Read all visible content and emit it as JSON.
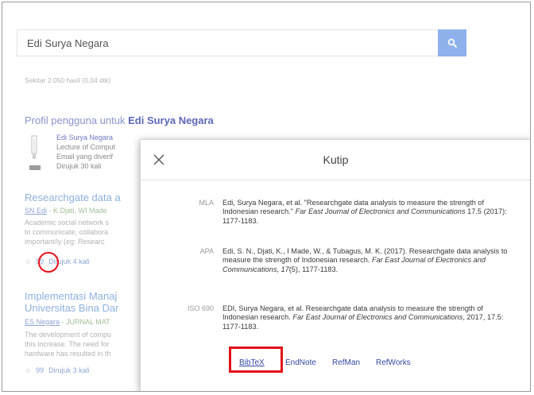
{
  "search": {
    "query": "Edi Surya Negara",
    "stats": "Sekitar 2.050 hasil (0,04 dtk)"
  },
  "profile": {
    "heading_prefix": "Profil pengguna untuk ",
    "heading_name": "Edi Surya Negara",
    "lines": [
      "Edi Surya Negara",
      "Lecture of Comput",
      "Email yang diverif",
      "Dirujuk 30 kali"
    ]
  },
  "results": [
    {
      "title": "Researchgate data a",
      "authors_link": "SN Edi",
      "authors_rest": " - K Djati, WI Made",
      "snippet": [
        "Academic social network s",
        "to communicate, collabora",
        "important/ly (eg: Researc"
      ],
      "cite_label": "99",
      "cited_by": "Dirujuk 4 kali"
    },
    {
      "title": "Implementasi Manaj",
      "title2": "Universitas Bina Dar",
      "authors_link": "ES Negara",
      "authors_rest": " - JURNAL MAT",
      "snippet": [
        "The development of compu",
        "this increase. The need for",
        "hardware has resulted in th"
      ],
      "cite_label": "99",
      "cited_by": "Dirujuk 3 kali"
    }
  ],
  "dialog": {
    "title": "Kutip",
    "citations": [
      {
        "style": "MLA",
        "pre": "Edi, Surya Negara, et al. \"Researchgate data analysis to measure the strength of Indonesian research.\" ",
        "journal": "Far East Journal of Electronics and Communications",
        "post": " 17.5 (2017): 1177-1183."
      },
      {
        "style": "APA",
        "pre": "Edi, S. N., Djati, K., I Made, W., & Tubagus, M. K. (2017). Researchgate data analysis to measure the strength of Indonesian research. ",
        "journal": "Far East Journal of Electronics and Communications, 17",
        "post": "(5), 1177-1183."
      },
      {
        "style": "ISO 690",
        "pre": "EDI, Surya Negara, et al. Researchgate data analysis to measure the strength of Indonesian research. ",
        "journal": "Far East Journal of Electronics and Communications",
        "post": ", 2017, 17.5: 1177-1183."
      }
    ],
    "exports": [
      "BibTeX",
      "EndNote",
      "RefMan",
      "RefWorks"
    ]
  },
  "colors": {
    "search_button": "#8fb2ec",
    "highlight_red": "#e21017",
    "link_blue": "#3348a3"
  }
}
